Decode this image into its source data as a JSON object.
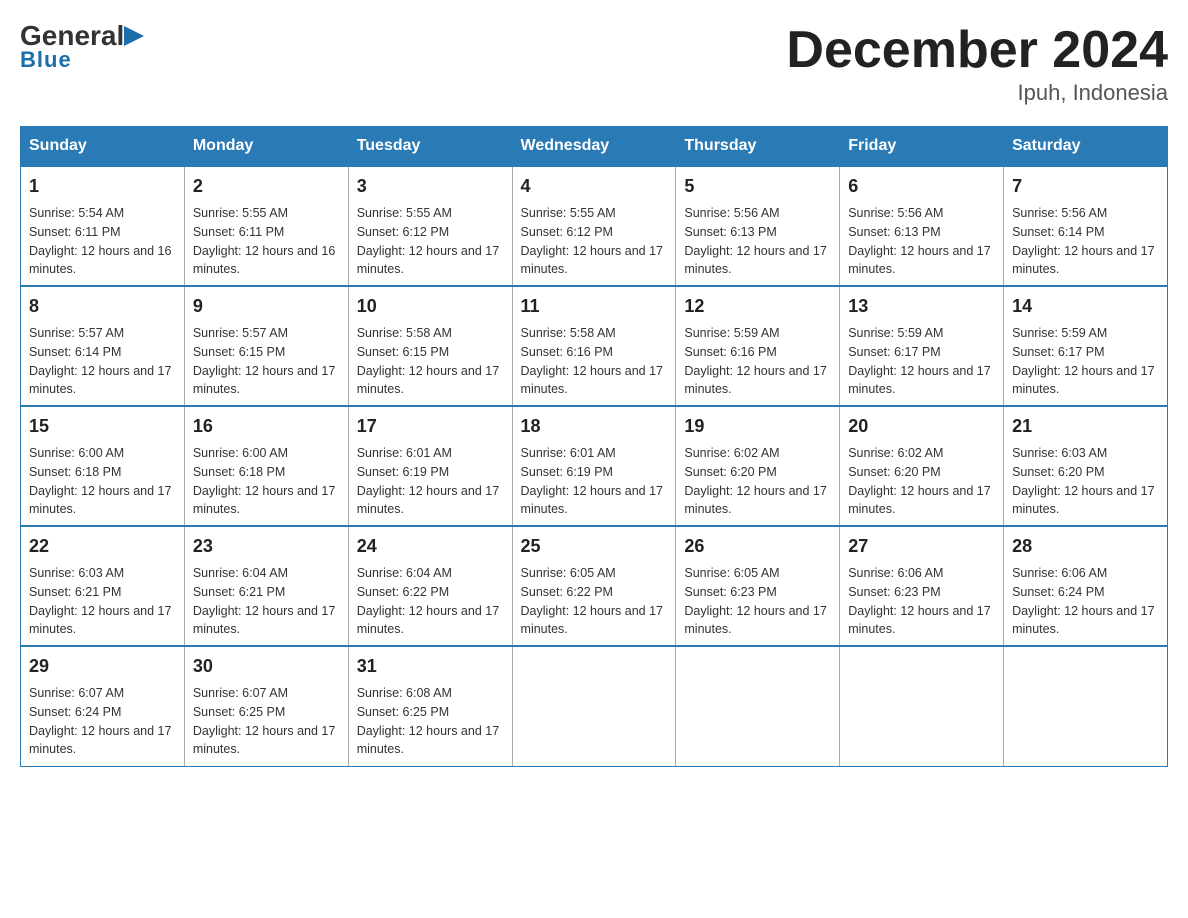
{
  "header": {
    "logo": {
      "general": "General",
      "arrow": "▶",
      "blue": "Blue"
    },
    "title": "December 2024",
    "subtitle": "Ipuh, Indonesia"
  },
  "days_of_week": [
    "Sunday",
    "Monday",
    "Tuesday",
    "Wednesday",
    "Thursday",
    "Friday",
    "Saturday"
  ],
  "weeks": [
    [
      {
        "day": "1",
        "sunrise": "Sunrise: 5:54 AM",
        "sunset": "Sunset: 6:11 PM",
        "daylight": "Daylight: 12 hours and 16 minutes."
      },
      {
        "day": "2",
        "sunrise": "Sunrise: 5:55 AM",
        "sunset": "Sunset: 6:11 PM",
        "daylight": "Daylight: 12 hours and 16 minutes."
      },
      {
        "day": "3",
        "sunrise": "Sunrise: 5:55 AM",
        "sunset": "Sunset: 6:12 PM",
        "daylight": "Daylight: 12 hours and 17 minutes."
      },
      {
        "day": "4",
        "sunrise": "Sunrise: 5:55 AM",
        "sunset": "Sunset: 6:12 PM",
        "daylight": "Daylight: 12 hours and 17 minutes."
      },
      {
        "day": "5",
        "sunrise": "Sunrise: 5:56 AM",
        "sunset": "Sunset: 6:13 PM",
        "daylight": "Daylight: 12 hours and 17 minutes."
      },
      {
        "day": "6",
        "sunrise": "Sunrise: 5:56 AM",
        "sunset": "Sunset: 6:13 PM",
        "daylight": "Daylight: 12 hours and 17 minutes."
      },
      {
        "day": "7",
        "sunrise": "Sunrise: 5:56 AM",
        "sunset": "Sunset: 6:14 PM",
        "daylight": "Daylight: 12 hours and 17 minutes."
      }
    ],
    [
      {
        "day": "8",
        "sunrise": "Sunrise: 5:57 AM",
        "sunset": "Sunset: 6:14 PM",
        "daylight": "Daylight: 12 hours and 17 minutes."
      },
      {
        "day": "9",
        "sunrise": "Sunrise: 5:57 AM",
        "sunset": "Sunset: 6:15 PM",
        "daylight": "Daylight: 12 hours and 17 minutes."
      },
      {
        "day": "10",
        "sunrise": "Sunrise: 5:58 AM",
        "sunset": "Sunset: 6:15 PM",
        "daylight": "Daylight: 12 hours and 17 minutes."
      },
      {
        "day": "11",
        "sunrise": "Sunrise: 5:58 AM",
        "sunset": "Sunset: 6:16 PM",
        "daylight": "Daylight: 12 hours and 17 minutes."
      },
      {
        "day": "12",
        "sunrise": "Sunrise: 5:59 AM",
        "sunset": "Sunset: 6:16 PM",
        "daylight": "Daylight: 12 hours and 17 minutes."
      },
      {
        "day": "13",
        "sunrise": "Sunrise: 5:59 AM",
        "sunset": "Sunset: 6:17 PM",
        "daylight": "Daylight: 12 hours and 17 minutes."
      },
      {
        "day": "14",
        "sunrise": "Sunrise: 5:59 AM",
        "sunset": "Sunset: 6:17 PM",
        "daylight": "Daylight: 12 hours and 17 minutes."
      }
    ],
    [
      {
        "day": "15",
        "sunrise": "Sunrise: 6:00 AM",
        "sunset": "Sunset: 6:18 PM",
        "daylight": "Daylight: 12 hours and 17 minutes."
      },
      {
        "day": "16",
        "sunrise": "Sunrise: 6:00 AM",
        "sunset": "Sunset: 6:18 PM",
        "daylight": "Daylight: 12 hours and 17 minutes."
      },
      {
        "day": "17",
        "sunrise": "Sunrise: 6:01 AM",
        "sunset": "Sunset: 6:19 PM",
        "daylight": "Daylight: 12 hours and 17 minutes."
      },
      {
        "day": "18",
        "sunrise": "Sunrise: 6:01 AM",
        "sunset": "Sunset: 6:19 PM",
        "daylight": "Daylight: 12 hours and 17 minutes."
      },
      {
        "day": "19",
        "sunrise": "Sunrise: 6:02 AM",
        "sunset": "Sunset: 6:20 PM",
        "daylight": "Daylight: 12 hours and 17 minutes."
      },
      {
        "day": "20",
        "sunrise": "Sunrise: 6:02 AM",
        "sunset": "Sunset: 6:20 PM",
        "daylight": "Daylight: 12 hours and 17 minutes."
      },
      {
        "day": "21",
        "sunrise": "Sunrise: 6:03 AM",
        "sunset": "Sunset: 6:20 PM",
        "daylight": "Daylight: 12 hours and 17 minutes."
      }
    ],
    [
      {
        "day": "22",
        "sunrise": "Sunrise: 6:03 AM",
        "sunset": "Sunset: 6:21 PM",
        "daylight": "Daylight: 12 hours and 17 minutes."
      },
      {
        "day": "23",
        "sunrise": "Sunrise: 6:04 AM",
        "sunset": "Sunset: 6:21 PM",
        "daylight": "Daylight: 12 hours and 17 minutes."
      },
      {
        "day": "24",
        "sunrise": "Sunrise: 6:04 AM",
        "sunset": "Sunset: 6:22 PM",
        "daylight": "Daylight: 12 hours and 17 minutes."
      },
      {
        "day": "25",
        "sunrise": "Sunrise: 6:05 AM",
        "sunset": "Sunset: 6:22 PM",
        "daylight": "Daylight: 12 hours and 17 minutes."
      },
      {
        "day": "26",
        "sunrise": "Sunrise: 6:05 AM",
        "sunset": "Sunset: 6:23 PM",
        "daylight": "Daylight: 12 hours and 17 minutes."
      },
      {
        "day": "27",
        "sunrise": "Sunrise: 6:06 AM",
        "sunset": "Sunset: 6:23 PM",
        "daylight": "Daylight: 12 hours and 17 minutes."
      },
      {
        "day": "28",
        "sunrise": "Sunrise: 6:06 AM",
        "sunset": "Sunset: 6:24 PM",
        "daylight": "Daylight: 12 hours and 17 minutes."
      }
    ],
    [
      {
        "day": "29",
        "sunrise": "Sunrise: 6:07 AM",
        "sunset": "Sunset: 6:24 PM",
        "daylight": "Daylight: 12 hours and 17 minutes."
      },
      {
        "day": "30",
        "sunrise": "Sunrise: 6:07 AM",
        "sunset": "Sunset: 6:25 PM",
        "daylight": "Daylight: 12 hours and 17 minutes."
      },
      {
        "day": "31",
        "sunrise": "Sunrise: 6:08 AM",
        "sunset": "Sunset: 6:25 PM",
        "daylight": "Daylight: 12 hours and 17 minutes."
      },
      null,
      null,
      null,
      null
    ]
  ]
}
